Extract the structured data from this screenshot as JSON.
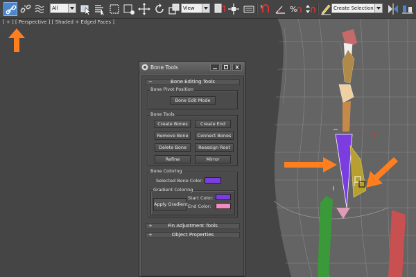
{
  "toolbar": {
    "selection_filter": "All",
    "reference_coord": "View",
    "named_selection_placeholder": "Create Selection Se",
    "icons": [
      "link-icon",
      "unlink-icon",
      "bind-space-warp-icon",
      "select-object-icon",
      "select-by-name-icon",
      "rectangular-selection-icon",
      "window-crossing-icon",
      "select-and-move-icon",
      "select-and-rotate-icon",
      "select-and-scale-icon",
      "mirror-icon",
      "use-pivot-center-icon",
      "select-and-manipulate-icon",
      "keyboard-shortcut-override-icon",
      "snaps-toggle-icon",
      "angle-snap-icon",
      "percent-snap-icon",
      "spinner-snap-icon",
      "edit-named-selection-icon",
      "mirror-tool-icon",
      "align-icon"
    ]
  },
  "viewport": {
    "label": "[ + ] [ Perspective ] [ Shaded + Edged Faces ]"
  },
  "bone_tools": {
    "title": "Bone Tools",
    "rollouts": {
      "editing": {
        "sign": "−",
        "title": "Bone Editing Tools"
      },
      "fin": {
        "sign": "+",
        "title": "Fin Adjustment Tools"
      },
      "object": {
        "sign": "+",
        "title": "Object Properties"
      }
    },
    "pivot_group": {
      "label": "Bone Pivot Position",
      "button": "Bone Edit Mode"
    },
    "tools_group": {
      "label": "Bone Tools",
      "buttons": {
        "create_bones": "Create Bones",
        "create_end": "Create End",
        "remove_bone": "Remove Bone",
        "connect_bones": "Connect Bones",
        "delete_bone": "Delete Bone",
        "reassign_root": "Reassign Root",
        "refine": "Refine",
        "mirror": "Mirror"
      }
    },
    "coloring_group": {
      "label": "Bone Coloring",
      "selected_label": "Selected Bone Color:",
      "selected_color": "#7b3de0",
      "gradient": {
        "label": "Gradient Coloring",
        "apply": "Apply Gradient",
        "start_label": "Start Color:",
        "start_color": "#7b3de0",
        "end_label": "End Color:",
        "end_color": "#f08cc0"
      }
    }
  },
  "colors": {
    "highlight_arrow": "#ff7f1f",
    "active_tool": "#4c86c8"
  }
}
